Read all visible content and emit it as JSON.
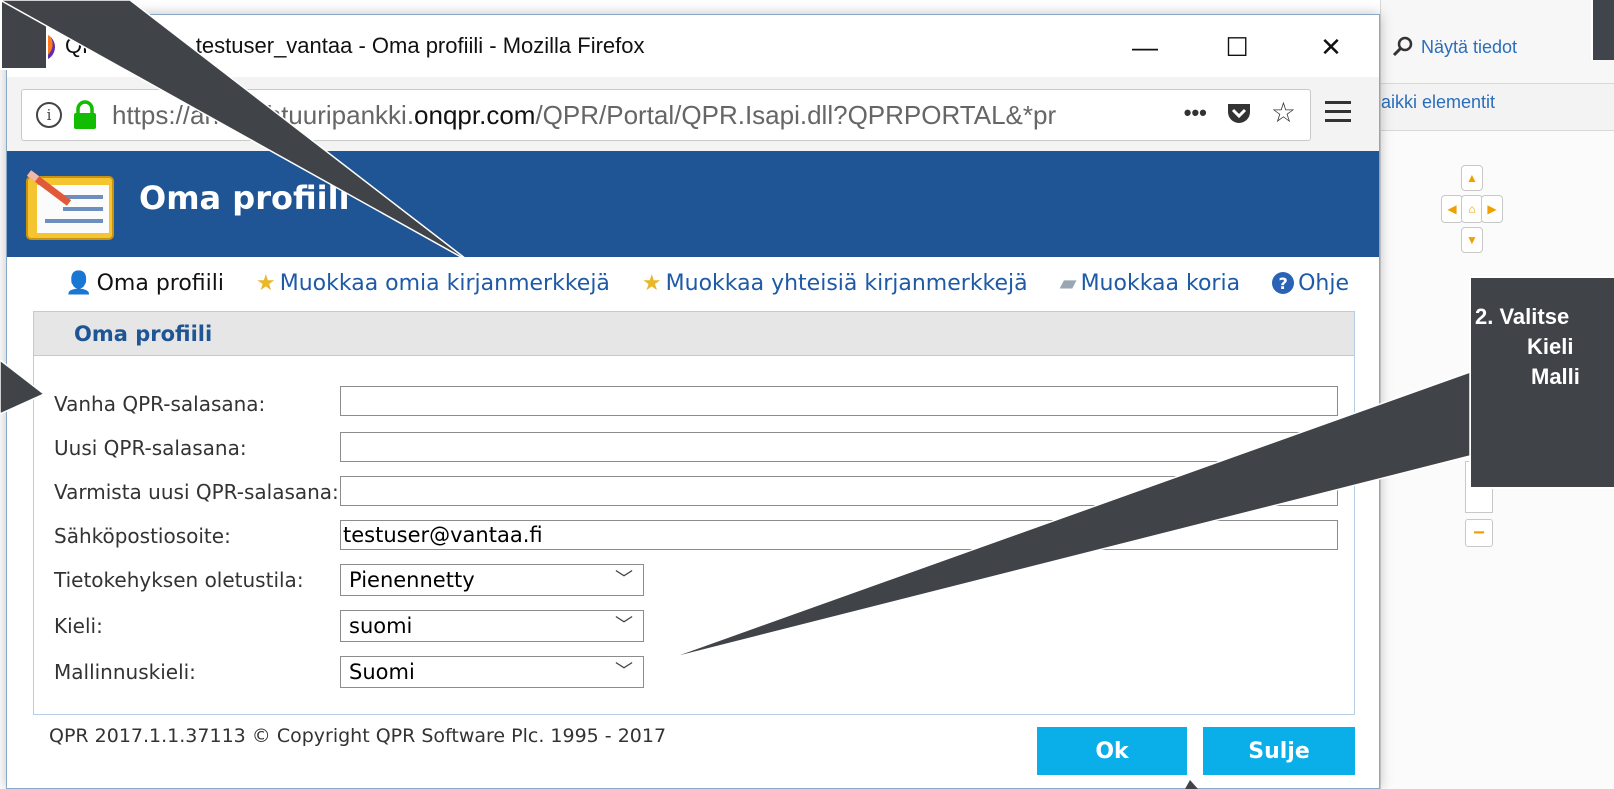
{
  "window": {
    "title": "QPR Portal - testuser_vantaa - Oma profiili - Mozilla Firefox",
    "minimize": "—",
    "maximize": "☐",
    "close": "✕"
  },
  "url": {
    "prefix": "https://",
    "host_pre": "arkkitehtuuripankki.",
    "host": "onqpr.com",
    "path": "/QPR/Portal/QPR.Isapi.dll?QPRPORTAL&*pr",
    "more": "•••"
  },
  "page": {
    "title": "Oma profiili"
  },
  "links": [
    {
      "label": "Oma profiili",
      "icon": "user-icon"
    },
    {
      "label": "Muokkaa omia kirjanmerkkejä",
      "icon": "star-bookmark-icon"
    },
    {
      "label": "Muokkaa yhteisiä kirjanmerkkejä",
      "icon": "star-bookmark-icon"
    },
    {
      "label": "Muokkaa koria",
      "icon": "basket-icon"
    },
    {
      "label": "Ohje",
      "icon": "help-icon"
    }
  ],
  "panel": {
    "title": "Oma profiili"
  },
  "form": {
    "old_password_label": "Vanha QPR-salasana:",
    "old_password_value": "",
    "new_password_label": "Uusi QPR-salasana:",
    "new_password_value": "",
    "confirm_password_label": "Varmista uusi QPR-salasana:",
    "confirm_password_value": "",
    "email_label": "Sähköpostiosoite:",
    "email_value": "testuser@vantaa.fi",
    "frame_state_label": "Tietokehyksen oletustila:",
    "frame_state_value": "Pienennetty",
    "language_label": "Kieli:",
    "language_value": "suomi",
    "modeling_language_label": "Mallinnuskieli:",
    "modeling_language_value": "Suomi"
  },
  "footer": {
    "copyright": "QPR 2017.1.1.37113 © Copyright QPR Software Plc. 1995 - 2017",
    "ok_label": "Ok",
    "close_label": "Sulje"
  },
  "background": {
    "show_details": "Näytä tiedot",
    "all_elements": "aikki elementit"
  },
  "callout": {
    "line1": "2. Valitse",
    "line2": "Kieli",
    "line3": "Malli"
  },
  "colors": {
    "header_bg": "#1f5594",
    "button_bg": "#0aaee8",
    "link": "#1e5aa6",
    "callout_bg": "#404448"
  }
}
